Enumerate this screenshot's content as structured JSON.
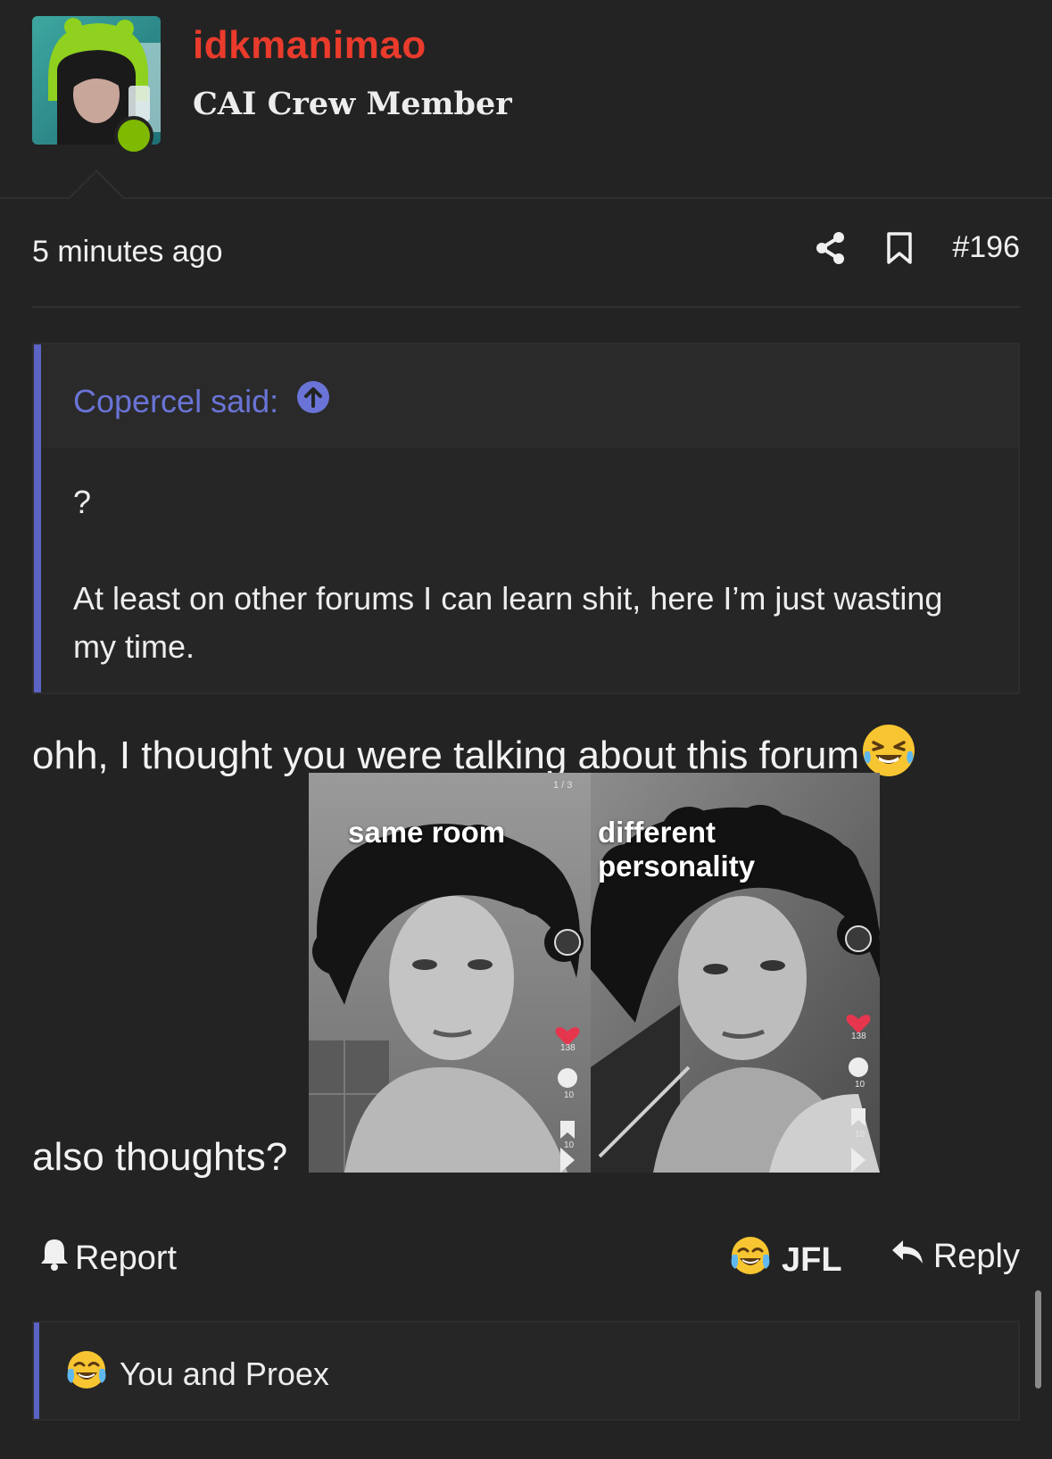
{
  "author": {
    "username": "idkmanimao",
    "title": "CAI Crew Member",
    "avatar_icon": "avatar-image",
    "online": true
  },
  "meta": {
    "time": "5 minutes ago",
    "post_number": "#196"
  },
  "quote": {
    "author_line": "Copercel said:",
    "line1": "?",
    "line2": "At least on other forums I can learn shit, here I’m just wasting my time."
  },
  "post": {
    "line1": "ohh, I thought you were talking about this forum",
    "line2": "also thoughts?"
  },
  "attachment": {
    "left_caption": "same room",
    "right_caption": "different personality",
    "counter": "1 / 3",
    "likes": "138",
    "comments": "10",
    "saves": "10"
  },
  "actions": {
    "report": "Report",
    "reaction": "JFL",
    "reply": "Reply"
  },
  "reactions": {
    "summary": "You and Proex"
  },
  "colors": {
    "background": "#232323",
    "username": "#ea3b2c",
    "accent": "#5b63c4",
    "link": "#6a74d6",
    "online": "#7fba00"
  }
}
